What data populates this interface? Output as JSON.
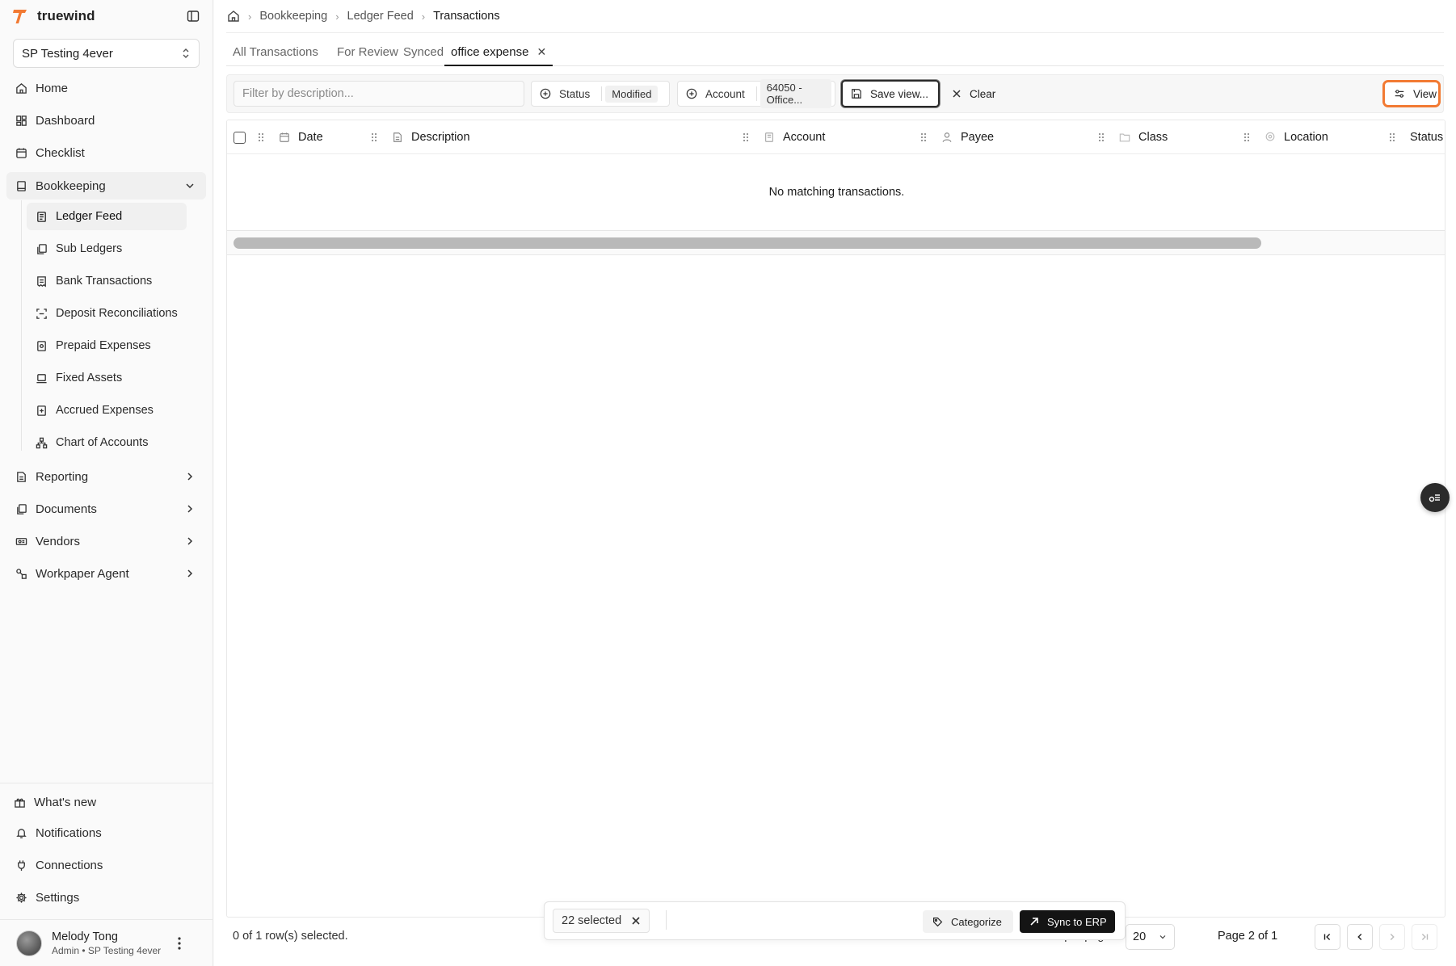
{
  "app": {
    "brand_name": "truewind",
    "brand_color": "#f27a33",
    "company": "SP Testing 4ever"
  },
  "sidebar": {
    "nav": [
      {
        "label": "Home",
        "icon": "home-icon"
      },
      {
        "label": "Dashboard",
        "icon": "dashboard-icon"
      },
      {
        "label": "Checklist",
        "icon": "calendar-icon"
      },
      {
        "label": "Bookkeeping",
        "icon": "book-icon",
        "expanded": true
      }
    ],
    "bookkeeping_items": [
      {
        "label": "Ledger Feed",
        "icon": "ledger-icon",
        "active": true
      },
      {
        "label": "Sub Ledgers",
        "icon": "copy-icon"
      },
      {
        "label": "Bank Transactions",
        "icon": "receipt-icon"
      },
      {
        "label": "Deposit Reconciliations",
        "icon": "scan-icon"
      },
      {
        "label": "Prepaid Expenses",
        "icon": "prepaid-icon"
      },
      {
        "label": "Fixed Assets",
        "icon": "laptop-icon"
      },
      {
        "label": "Accrued Expenses",
        "icon": "plus-square-icon"
      },
      {
        "label": "Chart of Accounts",
        "icon": "hierarchy-icon"
      }
    ],
    "groups": [
      {
        "label": "Reporting",
        "icon": "report-icon"
      },
      {
        "label": "Documents",
        "icon": "documents-icon"
      },
      {
        "label": "Vendors",
        "icon": "vendors-icon"
      },
      {
        "label": "Workpaper Agent",
        "icon": "agent-icon"
      }
    ],
    "bottom": [
      {
        "label": "What's new",
        "icon": "gift-icon"
      },
      {
        "label": "Notifications",
        "icon": "bell-icon"
      },
      {
        "label": "Connections",
        "icon": "plug-icon"
      },
      {
        "label": "Settings",
        "icon": "gear-icon"
      }
    ],
    "user": {
      "name": "Melody Tong",
      "role": "Admin • SP Testing 4ever"
    }
  },
  "breadcrumb": {
    "items": [
      "Bookkeeping",
      "Ledger Feed"
    ],
    "current": "Transactions"
  },
  "tabs": [
    {
      "label": "All Transactions"
    },
    {
      "label": "For Review"
    },
    {
      "label": "Synced"
    },
    {
      "label": "office expense",
      "active": true,
      "closable": true
    }
  ],
  "toolbar": {
    "filter_placeholder": "Filter by description...",
    "status_label": "Status",
    "status_value": "Modified",
    "account_label": "Account",
    "account_value": "64050 - Office...",
    "save_view_label": "Save view...",
    "clear_label": "Clear",
    "view_label": "View"
  },
  "table": {
    "columns": [
      "Date",
      "Description",
      "Account",
      "Payee",
      "Class",
      "Location",
      "Status"
    ],
    "empty_message": "No matching transactions."
  },
  "footer": {
    "selected_count": "0 of 1 row(s) selected.",
    "rows_per_page_label": "Rows per page",
    "rows_per_page_value": "20",
    "page_label": "Page 2 of 1"
  },
  "bulk_bar": {
    "selected_label": "22 selected",
    "categorize_label": "Categorize",
    "sync_label": "Sync to ERP"
  }
}
